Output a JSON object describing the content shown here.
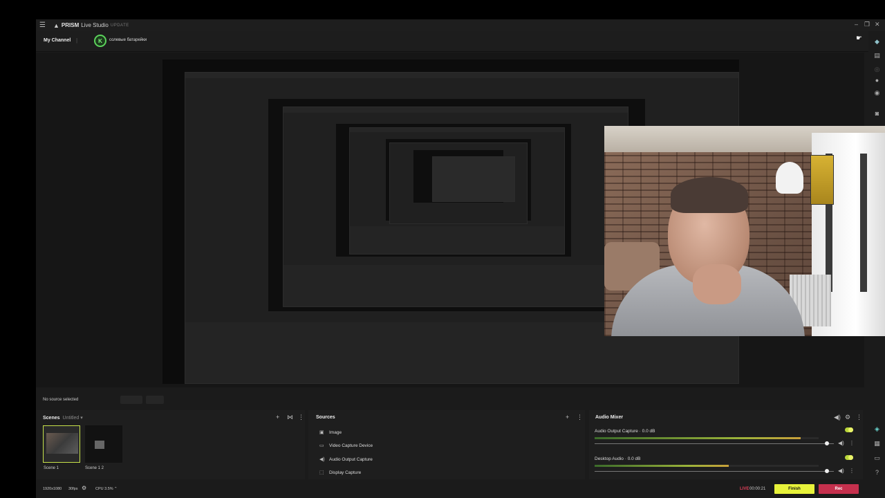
{
  "titlebar": {
    "app_name_bold": "PRISM",
    "app_name_light": "Live Studio",
    "update": "UPDATE"
  },
  "channel": {
    "label": "My Channel",
    "avatar_initial": "K",
    "name": "солевые батарейки"
  },
  "status": {
    "no_source": "No source selected"
  },
  "scenes": {
    "title": "Scenes",
    "collection": "Untitled",
    "items": [
      {
        "label": "Scene 1"
      },
      {
        "label": "Scene 1 2"
      }
    ]
  },
  "sources": {
    "title": "Sources",
    "items": [
      {
        "icon": "image-icon",
        "label": "Image"
      },
      {
        "icon": "video-icon",
        "label": "Video Capture Device"
      },
      {
        "icon": "speaker-icon",
        "label": "Audio Output Capture"
      },
      {
        "icon": "display-icon",
        "label": "Display Capture"
      }
    ]
  },
  "mixer": {
    "title": "Audio Mixer",
    "channels": [
      {
        "label": "Audio Output Capture · 0.0 dB",
        "level": 0.92,
        "volume": 0.97
      },
      {
        "label": "Desktop Audio · 0.0 dB",
        "level": 0.6,
        "volume": 0.97
      }
    ]
  },
  "bottombar": {
    "resolution": "1920x1080",
    "fps": "30fps",
    "cpu": "CPU 3.5%",
    "live": "LIVE",
    "timer": "00:00:21",
    "finish": "Finish",
    "rec": "Rec"
  },
  "colors": {
    "accent": "#e7f23a",
    "rec": "#c5304d",
    "live": "#e0405a",
    "active_scene_border": "#c8e34a"
  }
}
